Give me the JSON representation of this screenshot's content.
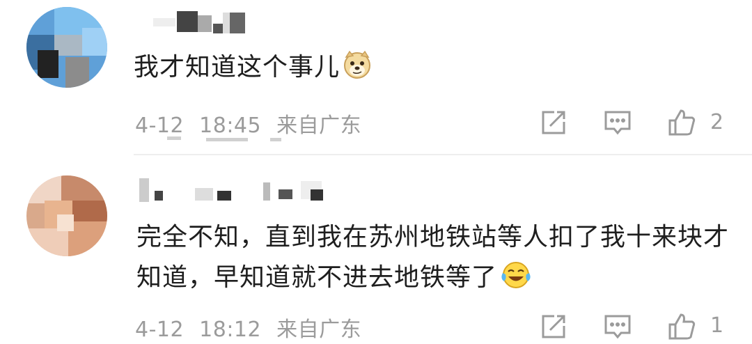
{
  "comments": [
    {
      "text": "我才知道这个事儿",
      "emoji": "doge",
      "date": "4-12",
      "time": "18:45",
      "location": "来自广东",
      "likes": "2"
    },
    {
      "text": "完全不知，直到我在苏州地铁站等人扣了我十来块才知道，早知道就不进去地铁等了",
      "emoji": "laugh-cry",
      "date": "4-12",
      "time": "18:12",
      "location": "来自广东",
      "likes": "1"
    }
  ],
  "icons": {
    "share": "share-icon",
    "reply": "comment-icon",
    "like": "thumbs-up-icon"
  }
}
